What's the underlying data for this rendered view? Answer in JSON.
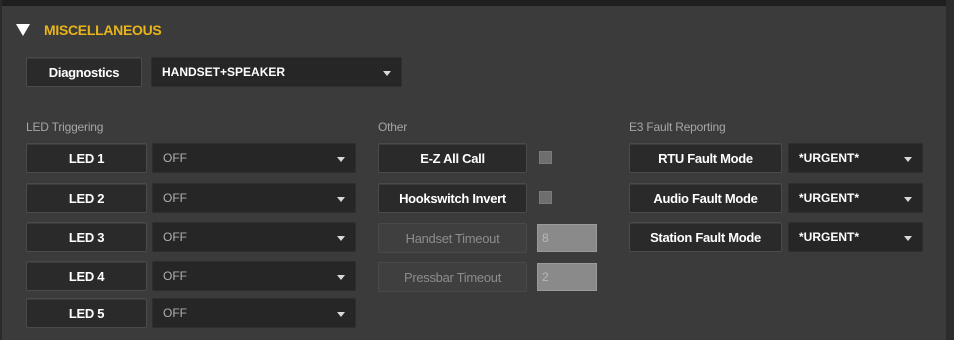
{
  "section": {
    "title": "MISCELLANEOUS"
  },
  "diagnostics": {
    "button_label": "Diagnostics",
    "mode_value": "HANDSET+SPEAKER"
  },
  "led_triggering": {
    "heading": "LED Triggering",
    "items": [
      {
        "label": "LED 1",
        "value": "OFF"
      },
      {
        "label": "LED 2",
        "value": "OFF"
      },
      {
        "label": "LED 3",
        "value": "OFF"
      },
      {
        "label": "LED 4",
        "value": "OFF"
      },
      {
        "label": "LED 5",
        "value": "OFF"
      }
    ]
  },
  "other": {
    "heading": "Other",
    "ez_all_call": {
      "label": "E-Z All Call",
      "checked": false
    },
    "hookswitch_invert": {
      "label": "Hookswitch Invert",
      "checked": false
    },
    "handset_timeout": {
      "label": "Handset Timeout",
      "value": "8"
    },
    "pressbar_timeout": {
      "label": "Pressbar Timeout",
      "value": "2"
    }
  },
  "e3_fault": {
    "heading": "E3 Fault Reporting",
    "items": [
      {
        "label": "RTU Fault Mode",
        "value": "*URGENT*"
      },
      {
        "label": "Audio Fault Mode",
        "value": "*URGENT*"
      },
      {
        "label": "Station Fault Mode",
        "value": "*URGENT*"
      }
    ]
  },
  "colors": {
    "accent": "#e8b419",
    "background": "#3b3b3b",
    "button": "#2a2a2a"
  }
}
